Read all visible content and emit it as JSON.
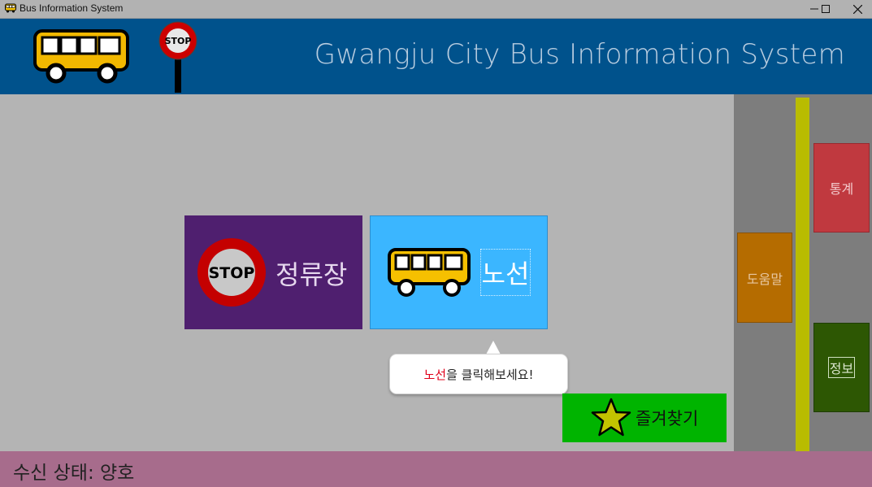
{
  "window": {
    "title": "Bus Information System"
  },
  "header": {
    "title": "Gwangju City Bus Information System"
  },
  "tiles": {
    "stop_label": "정류장",
    "route_label": "노선",
    "stop_sign_text": "STOP"
  },
  "tooltip": {
    "highlight": "노선",
    "rest": "을 클릭해보세요!"
  },
  "favorites": {
    "label": "즐겨찾기"
  },
  "side": {
    "help_label": "도움말",
    "stats_label": "통계",
    "info_label": "정보"
  },
  "status": {
    "text": "수신 상태: 양호"
  },
  "colors": {
    "header": "#00528c",
    "stop_tile": "#4f1f6f",
    "route_tile": "#3bb6ff",
    "favorites": "#00b400",
    "status_bar": "#a76c8c",
    "help": "#b56c00",
    "stats": "#c0393f",
    "info": "#2d5703"
  },
  "icons": [
    "bus-icon",
    "stop-sign-icon",
    "star-icon",
    "minimize-icon",
    "maximize-icon",
    "close-icon"
  ]
}
